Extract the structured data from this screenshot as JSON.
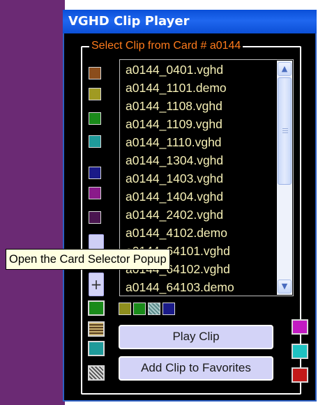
{
  "window": {
    "title": "VGHD Clip Player"
  },
  "group": {
    "title": "Select Clip from Card # a0144"
  },
  "clips": [
    "a0144_0401.vghd",
    "a0144_1101.demo",
    "a0144_1108.vghd",
    "a0144_1109.vghd",
    "a0144_1110.vghd",
    "a0144_1304.vghd",
    "a0144_1403.vghd",
    "a0144_1404.vghd",
    "a0144_2402.vghd",
    "a0144_4102.demo",
    "a0144_64101.vghd",
    "a0144_64102.vghd",
    "a0144_64103.demo"
  ],
  "buttons": {
    "play": "Play Clip",
    "add_favorite": "Add Clip to Favorites",
    "plus": "+"
  },
  "tooltip": "Open the Card Selector Popup",
  "colors": {
    "left_swatches": [
      "#8b4d1c",
      "#a09a22",
      "#1a8a1a",
      "#1f9a9a",
      "#1a1a88",
      "#8a1a8a",
      "#4a1650"
    ],
    "bottom_row": [
      "#1a8a1a"
    ],
    "small_row": [
      "#8e8e1e",
      "#1a8a1a",
      "#b0c8c8",
      "#1a1a88"
    ],
    "right_column": [
      "#c21ac2",
      "#1fc2c2",
      "#c21a1a"
    ],
    "lower_left": [
      "#bfa860",
      "#1f9a9a",
      "#9a9a9a"
    ]
  }
}
